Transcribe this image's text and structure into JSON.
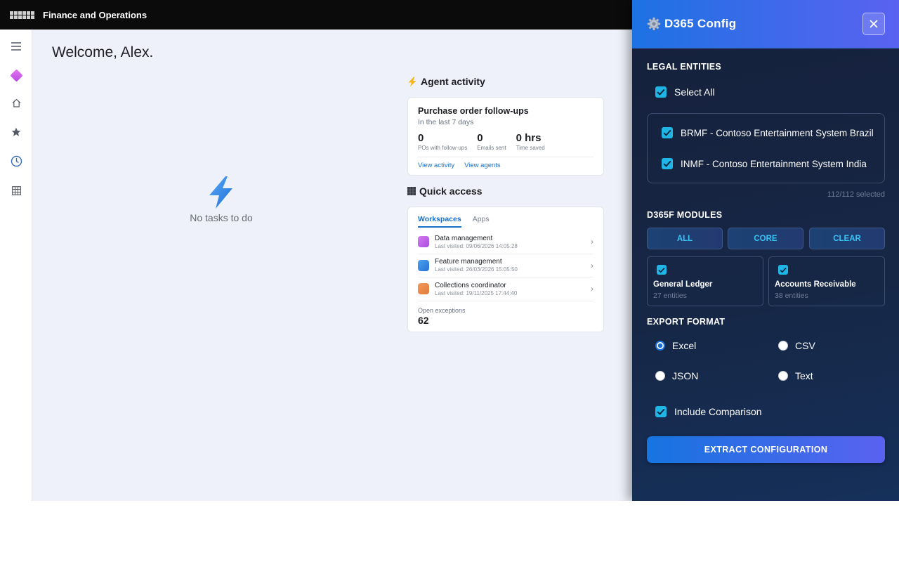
{
  "topbar": {
    "app_title": "Finance and Operations"
  },
  "rail": {
    "icons": [
      "menu-icon",
      "copilot-icon",
      "home-icon",
      "star-icon",
      "recent-icon",
      "grid-icon"
    ]
  },
  "main": {
    "welcome": "Welcome, Alex.",
    "no_tasks": "No tasks to do",
    "agent_activity": {
      "heading": "Agent activity",
      "card_title": "Purchase order follow-ups",
      "card_subtitle": "In the last 7 days",
      "stats": [
        {
          "value": "0",
          "label": "POs with follow-ups"
        },
        {
          "value": "0",
          "label": "Emails sent"
        },
        {
          "value": "0 hrs",
          "label": "Time saved"
        }
      ],
      "links": [
        "View activity",
        "View agents"
      ]
    },
    "quick_access": {
      "heading": "Quick access",
      "tabs": [
        "Workspaces",
        "Apps"
      ],
      "active_tab": "Workspaces",
      "workspaces": [
        {
          "name": "Data management",
          "last_visited": "Last visited: 09/06/2026 14:05:28",
          "color": "#c060e8"
        },
        {
          "name": "Feature management",
          "last_visited": "Last visited: 26/03/2026 15:05:50",
          "color": "#3a8ee6"
        },
        {
          "name": "Collections coordinator",
          "last_visited": "Last visited: 19/11/2025 17:44:40",
          "color": "#ef8a48"
        }
      ],
      "open_exceptions_label": "Open exceptions",
      "open_exceptions_value": "62"
    }
  },
  "panel": {
    "title": "D365 Config",
    "legal_entities": {
      "heading": "LEGAL ENTITIES",
      "select_all": "Select All",
      "select_all_checked": true,
      "entities": [
        {
          "label": "BRMF - Contoso Entertainment System Brazil",
          "checked": true
        },
        {
          "label": "INMF - Contoso Entertainment System India",
          "checked": true
        }
      ],
      "selected_count": "112/112 selected"
    },
    "modules": {
      "heading": "D365F MODULES",
      "buttons": [
        "ALL",
        "CORE",
        "CLEAR"
      ],
      "items": [
        {
          "name": "General Ledger",
          "count": "27 entities",
          "checked": true
        },
        {
          "name": "Accounts Receivable",
          "count": "38 entities",
          "checked": true
        }
      ]
    },
    "export_format": {
      "heading": "EXPORT FORMAT",
      "options": [
        "Excel",
        "CSV",
        "JSON",
        "Text"
      ],
      "selected": "Excel"
    },
    "include_comparison": {
      "label": "Include Comparison",
      "checked": true
    },
    "extract_button": "EXTRACT CONFIGURATION"
  },
  "colors": {
    "accent": "#1a6fc9",
    "panel_header_start": "#1d72e3",
    "panel_header_end": "#5a62f0",
    "checkbox": "#1fb6e6"
  }
}
